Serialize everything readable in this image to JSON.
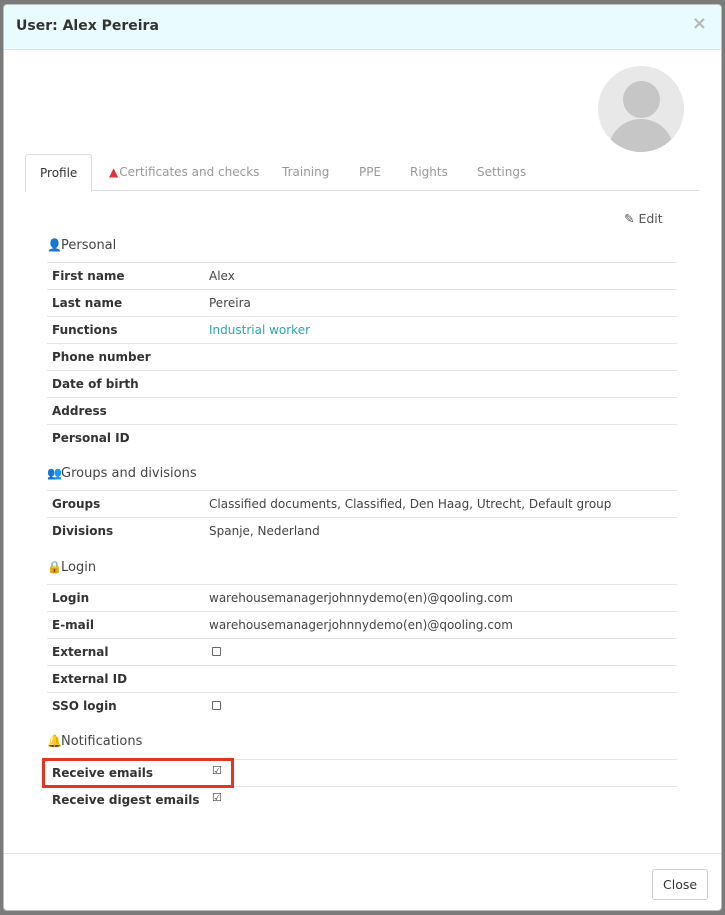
{
  "modal": {
    "title": "User: Alex Pereira",
    "close_glyph": "×",
    "close_button": "Close"
  },
  "tabs": [
    {
      "label": "Profile",
      "active": true
    },
    {
      "label": "Certificates and checks",
      "icon": "warning-icon"
    },
    {
      "label": "Training"
    },
    {
      "label": "PPE"
    },
    {
      "label": "Rights"
    },
    {
      "label": "Settings"
    }
  ],
  "edit_label": "Edit",
  "sections": {
    "personal": {
      "title": "Personal",
      "rows": [
        {
          "label": "First name",
          "value": "Alex"
        },
        {
          "label": "Last name",
          "value": "Pereira"
        },
        {
          "label": "Functions",
          "value": "Industrial worker"
        },
        {
          "label": "Phone number",
          "value": ""
        },
        {
          "label": "Date of birth",
          "value": ""
        },
        {
          "label": "Address",
          "value": ""
        },
        {
          "label": "Personal ID",
          "value": ""
        }
      ]
    },
    "groups": {
      "title": "Groups and divisions",
      "rows": [
        {
          "label": "Groups",
          "value": "Classified documents, Classified, Den Haag, Utrecht, Default group"
        },
        {
          "label": "Divisions",
          "value": "Spanje, Nederland"
        }
      ]
    },
    "login": {
      "title": "Login",
      "rows": [
        {
          "label": "Login",
          "value": "warehousemanagerjohnnydemo(en)@qooling.com"
        },
        {
          "label": "E-mail",
          "value": "warehousemanagerjohnnydemo(en)@qooling.com"
        },
        {
          "label": "External",
          "checked": false
        },
        {
          "label": "External ID",
          "value": ""
        },
        {
          "label": "SSO login",
          "checked": false
        }
      ]
    },
    "notifications": {
      "title": "Notifications",
      "rows": [
        {
          "label": "Receive emails",
          "checked": true
        },
        {
          "label": "Receive digest emails",
          "checked": true
        }
      ]
    }
  },
  "colors": {
    "header_bg": "#e9fbfd",
    "link": "#2aa7b4",
    "warning": "#e0333a",
    "highlight": "#e43522"
  }
}
